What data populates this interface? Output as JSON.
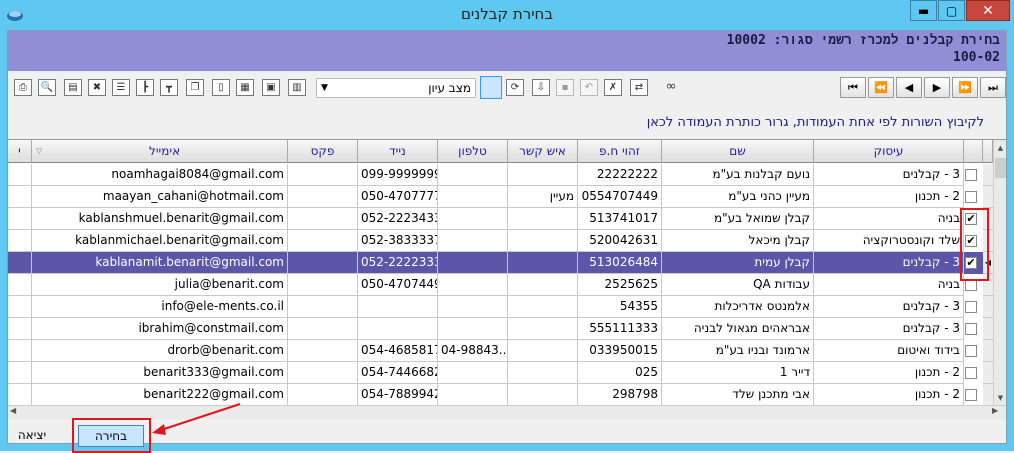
{
  "window": {
    "title": "בחירת קבלנים",
    "minimize": "▬",
    "maximize": "▢",
    "close": "✕"
  },
  "header": {
    "line1": "בחירת קבלנים למכרז רשמי סגור: 10002",
    "line2": "100-02"
  },
  "toolbar": {
    "mode_label": "מצב עיון",
    "icons": [
      "printer-icon",
      "print-preview-icon",
      "export-icon",
      "excel-icon",
      "list-icon",
      "tree-icon",
      "tree2-icon",
      "copy-icon",
      "page-icon",
      "save-grid-icon",
      "filter-icon",
      "columns-icon"
    ],
    "nav": {
      "first": "⏮",
      "prev_page": "⏪",
      "prev": "◀",
      "next": "▶",
      "next_page": "⏩",
      "last": "⏭"
    }
  },
  "hint": "לקיבוץ השורות לפי אחת העמודות, גרור כותרת העמודה לכאן",
  "grid": {
    "columns": {
      "sector": "עיסוק",
      "name": "שם",
      "id": "זהוי ח.פ",
      "contact": "איש קשר",
      "phone": "טלפון",
      "mobile": "נייד",
      "fax": "פקס",
      "email": "אימייל",
      "extra": "י"
    },
    "rows": [
      {
        "checked": false,
        "sector": "3 - קבלנים",
        "name": "נועם קבלנות בע\"מ",
        "id": "22222222",
        "contact": "",
        "phone": "",
        "mobile": "099-9999999",
        "fax": "",
        "email": "noamhagai8084@gmail.com"
      },
      {
        "checked": false,
        "sector": "2 - תכנון",
        "name": "מעיין כהני בע\"מ",
        "id": "0554707449",
        "contact": "מעיין",
        "phone": "",
        "mobile": "050-4707777",
        "fax": "",
        "email": "maayan_cahani@hotmail.com"
      },
      {
        "checked": true,
        "sector": "בניה",
        "name": "קבלן שמואל בע\"מ",
        "id": "513741017",
        "contact": "",
        "phone": "",
        "mobile": "052-2223433",
        "fax": "",
        "email": "kablanshmuel.benarit@gmail.com"
      },
      {
        "checked": true,
        "sector": "שלד וקונסטרוקציה",
        "name": "קבלן מיכאל",
        "id": "520042631",
        "contact": "",
        "phone": "",
        "mobile": "052-3833337",
        "fax": "",
        "email": "kablanmichael.benarit@gmail.com"
      },
      {
        "checked": true,
        "selected": true,
        "sector": "3 - קבלנים",
        "name": "קבלן עמית",
        "id": "513026484",
        "contact": "",
        "phone": "",
        "mobile": "052-2222333",
        "fax": "",
        "email": "kablanamit.benarit@gmail.com"
      },
      {
        "checked": false,
        "sector": "בניה",
        "name": "עבודות QA",
        "id": "2525625",
        "contact": "",
        "phone": "",
        "mobile": "050-4707449",
        "fax": "",
        "email": "julia@benarit.com"
      },
      {
        "checked": false,
        "sector": "3 - קבלנים",
        "name": "אלמנטס אדריכלות",
        "id": "54355",
        "contact": "",
        "phone": "",
        "mobile": "",
        "fax": "",
        "email": "info@ele-ments.co.il"
      },
      {
        "checked": false,
        "sector": "3 - קבלנים",
        "name": "אבראהים מגאול לבניה",
        "id": "555111333",
        "contact": "",
        "phone": "",
        "mobile": "",
        "fax": "",
        "email": "ibrahim@constmail.com"
      },
      {
        "checked": false,
        "sector": "בידוד ואיטום",
        "name": "ארמונד ובניו בע\"מ",
        "id": "033950015",
        "contact": "",
        "phone": "04-98843...",
        "mobile": "054-4685817",
        "fax": "",
        "email": "drorb@benarit.com"
      },
      {
        "checked": false,
        "sector": "2 - תכנון",
        "name": "דייר 1",
        "id": "025",
        "contact": "",
        "phone": "",
        "mobile": "054-7446682",
        "fax": "",
        "email": "benarit333@gmail.com"
      },
      {
        "checked": false,
        "sector": "2 - תכנון",
        "name": "אבי מתכנן שלד",
        "id": "298798",
        "contact": "",
        "phone": "",
        "mobile": "054-7889942",
        "fax": "",
        "email": "benarit222@gmail.com"
      }
    ]
  },
  "buttons": {
    "choose": "בחירה",
    "exit": "יציאה"
  },
  "colors": {
    "header_band": "#8f8fd6",
    "selected_row": "#5b56a8",
    "annotation": "#e0181e",
    "titlebar": "#5fc8f0"
  }
}
